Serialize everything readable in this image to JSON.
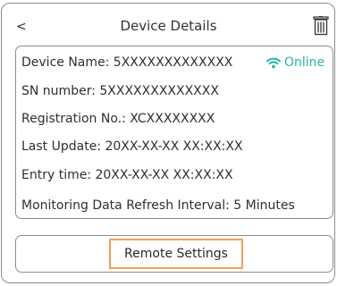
{
  "header": {
    "back_label": "<",
    "title": "Device Details",
    "trash_icon": "trash-icon"
  },
  "details": {
    "device_name": "Device Name: 5XXXXXXXXXXXXX",
    "status": "Online",
    "status_color": "#25b3a6",
    "sn_number": "SN number: 5XXXXXXXXXXXXX",
    "registration_no": "Registration No.: XCXXXXXXXX",
    "last_update": "Last Update: 20XX-XX-XX XX:XX:XX",
    "entry_time": "Entry time: 20XX-XX-XX XX:XX:XX",
    "refresh_interval": "Monitoring Data Refresh Interval: 5 Minutes"
  },
  "actions": {
    "remote_settings_label": "Remote Settings",
    "highlight_color": "#f0a05a"
  }
}
